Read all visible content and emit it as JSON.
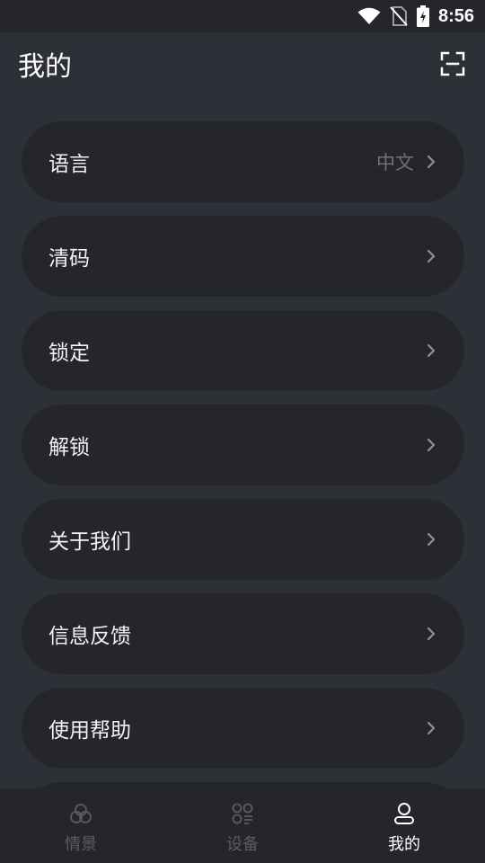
{
  "status_bar": {
    "time": "8:56"
  },
  "header": {
    "title": "我的"
  },
  "menu": [
    {
      "label": "语言",
      "value": "中文"
    },
    {
      "label": "清码",
      "value": ""
    },
    {
      "label": "锁定",
      "value": ""
    },
    {
      "label": "解锁",
      "value": ""
    },
    {
      "label": "关于我们",
      "value": ""
    },
    {
      "label": "信息反馈",
      "value": ""
    },
    {
      "label": "使用帮助",
      "value": ""
    }
  ],
  "bottom_nav": {
    "items": [
      {
        "label": "情景",
        "icon": "scene-icon",
        "active": false
      },
      {
        "label": "设备",
        "icon": "devices-icon",
        "active": false
      },
      {
        "label": "我的",
        "icon": "profile-icon",
        "active": true
      }
    ]
  },
  "colors": {
    "background": "#2e3037",
    "card": "#25262c",
    "text": "#f2f2f2",
    "muted": "#6f7178",
    "nav_inactive": "#5a5c63",
    "nav_active": "#ffffff"
  }
}
